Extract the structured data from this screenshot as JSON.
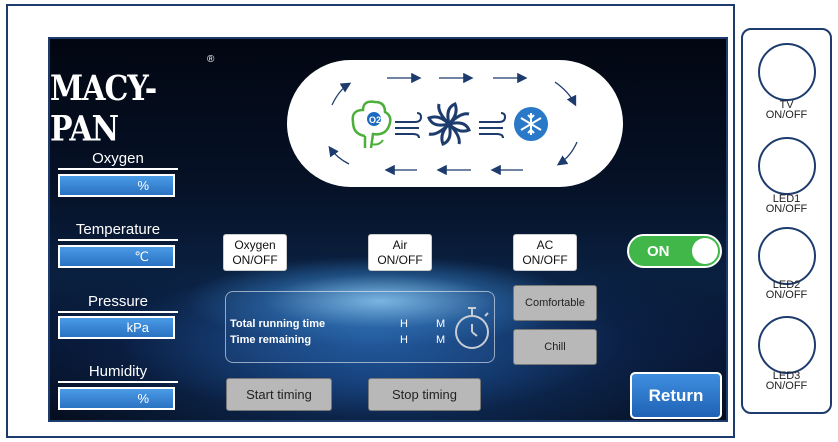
{
  "brand": {
    "logo_text": "MACY-PAN",
    "registered_mark": "®"
  },
  "stats": [
    {
      "label": "Oxygen",
      "unit": "%"
    },
    {
      "label": "Temperature",
      "unit": "℃"
    },
    {
      "label": "Pressure",
      "unit": "kPa"
    },
    {
      "label": "Humidity",
      "unit": "%"
    }
  ],
  "flow_diagram": {
    "o2_text": "O2",
    "icons": [
      "tree-oxygen-icon",
      "wind-icon",
      "fan-icon",
      "wind-icon",
      "snowflake-icon"
    ]
  },
  "controls": {
    "oxygen": {
      "line1": "Oxygen",
      "line2": "ON/OFF"
    },
    "air": {
      "line1": "Air",
      "line2": "ON/OFF"
    },
    "ac": {
      "line1": "AC",
      "line2": "ON/OFF"
    },
    "power_toggle": {
      "label": "ON",
      "state": "on",
      "color": "#41b74a"
    }
  },
  "modes": {
    "comfortable": "Comfortable",
    "chill": "Chill"
  },
  "timer": {
    "total_running_label": "Total running time",
    "time_remaining_label": "Time  remaining",
    "hours_unit": "H",
    "minutes_unit": "M"
  },
  "buttons": {
    "start_timing": "Start timing",
    "stop_timing": "Stop timing",
    "return": "Return"
  },
  "side_buttons": [
    {
      "line1": "TV",
      "line2": "ON/OFF"
    },
    {
      "line1": "LED1",
      "line2": "ON/OFF"
    },
    {
      "line1": "LED2",
      "line2": "ON/OFF"
    },
    {
      "line1": "LED3",
      "line2": "ON/OFF"
    }
  ],
  "colors": {
    "frame": "#1d3b6c",
    "accent_blue": "#2a72c2",
    "toggle_green": "#41b74a",
    "flow_green": "#4caf3a"
  }
}
